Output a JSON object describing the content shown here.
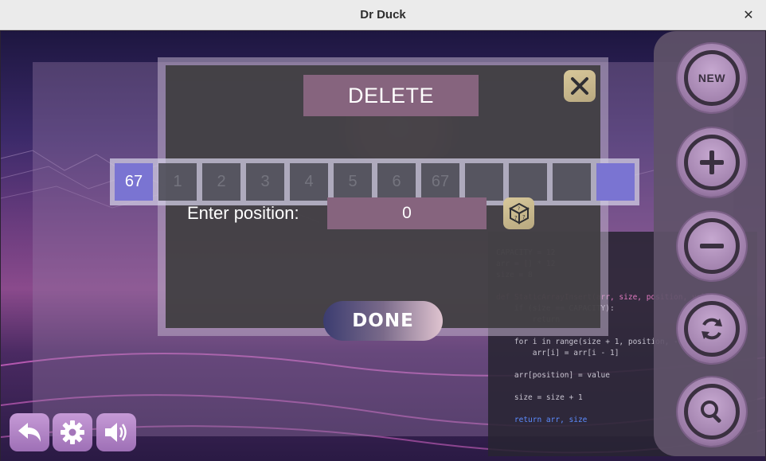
{
  "window": {
    "title": "Dr Duck",
    "close_glyph": "✕"
  },
  "dialog": {
    "title": "DELETE",
    "position_label": "Enter position:",
    "position_value": "0",
    "done_label": "DONE",
    "close_icon": "close-icon",
    "random_icon": "dice-icon"
  },
  "array": {
    "cells": [
      "67",
      "1",
      "2",
      "3",
      "4",
      "5",
      "6",
      "67",
      "",
      "",
      "",
      ""
    ],
    "active_index": 0
  },
  "side_buttons": [
    {
      "name": "new-button",
      "label": "NEW",
      "icon": "sparkle-icon"
    },
    {
      "name": "insert-button",
      "icon": "plus-icon"
    },
    {
      "name": "remove-button",
      "icon": "minus-icon"
    },
    {
      "name": "reset-button",
      "icon": "refresh-icon"
    },
    {
      "name": "search-button",
      "icon": "search-icon"
    }
  ],
  "bottom_buttons": [
    {
      "name": "back-button",
      "icon": "undo-arrow-icon"
    },
    {
      "name": "settings-button",
      "icon": "gear-icon"
    },
    {
      "name": "sound-button",
      "icon": "speaker-icon"
    }
  ],
  "code": {
    "lines": [
      "",
      "CAPACITY = 12",
      "arr = [] * 12",
      "size = 8",
      "",
      "def StaticArrayInsert(arr, size, position, value):",
      "    if (size == CAPACITY):",
      "        return",
      "",
      "    for i in range(size + 1, position, -1):",
      "        arr[i] = arr[i - 1]",
      "",
      "    arr[position] = value",
      "",
      "    size = size + 1",
      "",
      "    return arr, size"
    ]
  },
  "colors": {
    "dialog_title_bg": "#86647e",
    "active_cell": "#7a74d2",
    "accent_gold": "#d8c89a"
  }
}
